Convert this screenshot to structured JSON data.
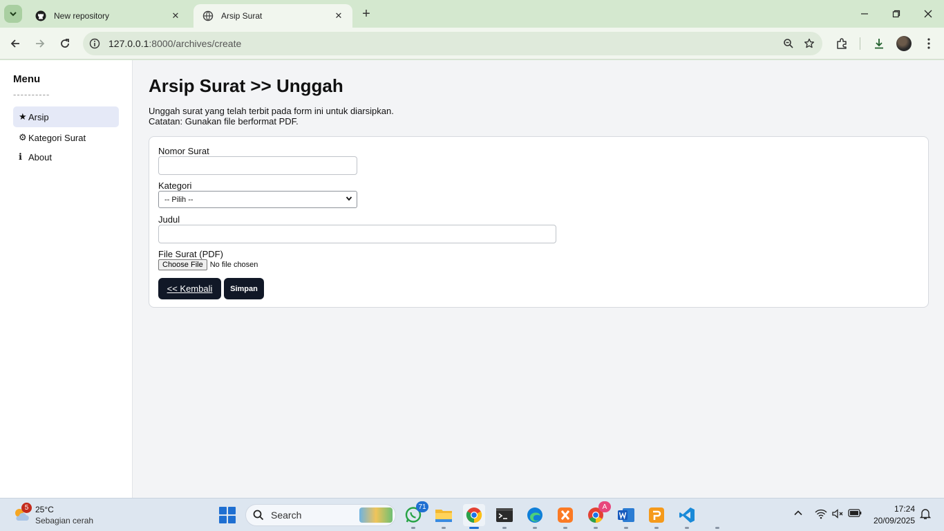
{
  "browser": {
    "tabs": [
      {
        "title": "New repository",
        "favicon": "github-icon"
      },
      {
        "title": "Arsip Surat",
        "favicon": "globe-icon"
      }
    ],
    "address": {
      "host": "127.0.0.1",
      "path": ":8000/archives/create"
    }
  },
  "sidebar": {
    "title": "Menu",
    "divider": "----------",
    "items": [
      {
        "icon": "★",
        "label": "Arsip",
        "active": true
      },
      {
        "icon": "⚙",
        "label": "Kategori Surat"
      },
      {
        "icon": "ℹ",
        "label": "About"
      }
    ]
  },
  "main": {
    "title": "Arsip Surat >> Unggah",
    "description": [
      "Unggah surat yang telah terbit pada form ini untuk diarsipkan.",
      "Catatan: Gunakan file berformat PDF."
    ],
    "form": {
      "nomor_label": "Nomor Surat",
      "nomor_value": "",
      "kategori_label": "Kategori",
      "kategori_selected": "-- Pilih --",
      "judul_label": "Judul",
      "judul_value": "",
      "file_label": "File Surat (PDF)",
      "file_button": "Choose File",
      "file_status": "No file chosen",
      "back_button": "<< Kembali",
      "save_button": "Simpan"
    }
  },
  "taskbar": {
    "weather": {
      "temp": "25°C",
      "desc": "Sebagian cerah",
      "badge": "5"
    },
    "search_label": "Search",
    "whatsapp_badge": "71",
    "chrome_profile_badge": "A",
    "clock": {
      "time": "17:24",
      "date": "20/09/2025"
    }
  }
}
